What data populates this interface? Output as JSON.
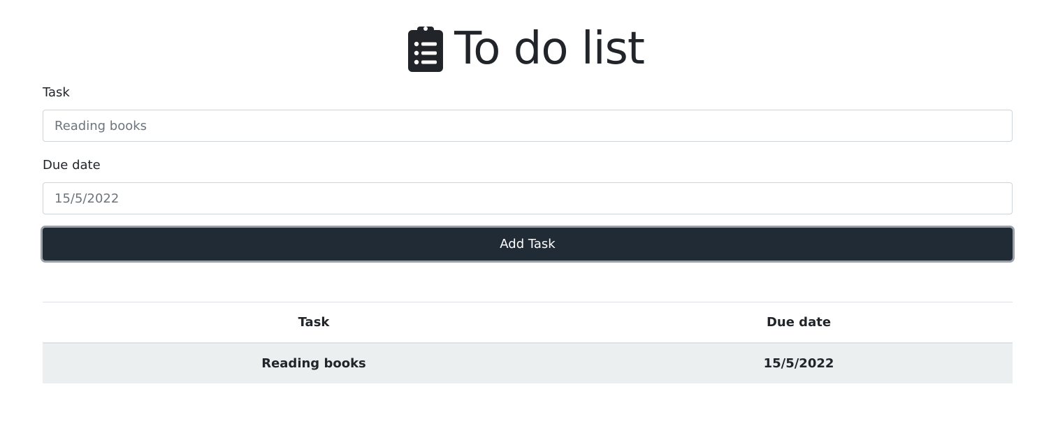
{
  "header": {
    "icon": "clipboard-list-icon",
    "title": "To do list"
  },
  "form": {
    "task_label": "Task",
    "task_placeholder": "Reading books",
    "task_value": "",
    "due_label": "Due date",
    "due_placeholder": "15/5/2022",
    "due_value": "",
    "add_button_label": "Add Task"
  },
  "table": {
    "headers": [
      "Task",
      "Due date"
    ],
    "rows": [
      {
        "task": "Reading books",
        "due": "15/5/2022"
      }
    ]
  },
  "colors": {
    "text": "#212529",
    "button_bg": "#212b36",
    "row_bg": "#eceff0",
    "border": "#ced4da"
  }
}
